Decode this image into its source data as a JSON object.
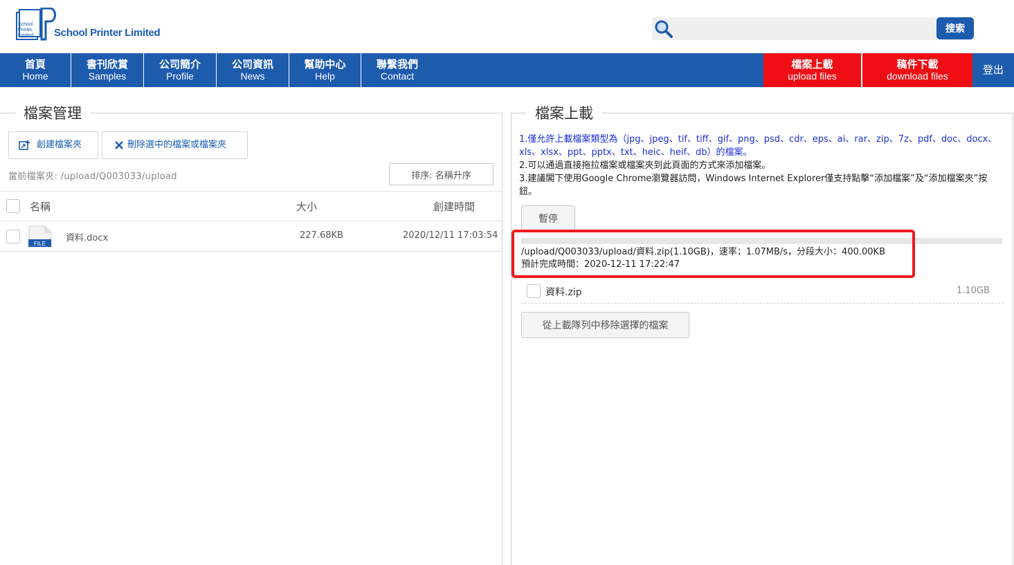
{
  "header": {
    "logo_text": "School Printer Limited",
    "logo_mark_lines": [
      "School",
      "Printer",
      "Limited"
    ],
    "search": {
      "placeholder": "",
      "button_label": "搜索"
    }
  },
  "nav": {
    "items": [
      {
        "zh": "首頁",
        "en": "Home"
      },
      {
        "zh": "書刊欣賞",
        "en": "Samples"
      },
      {
        "zh": "公司簡介",
        "en": "Profile"
      },
      {
        "zh": "公司資訊",
        "en": "News"
      },
      {
        "zh": "幫助中心",
        "en": "Help"
      },
      {
        "zh": "聯繫我們",
        "en": "Contact"
      }
    ],
    "actions": [
      {
        "zh": "檔案上載",
        "en": "upload files"
      },
      {
        "zh": "稿件下載",
        "en": "download files"
      }
    ],
    "logout_label": "登出"
  },
  "file_manager": {
    "title": "檔案管理",
    "create_folder_label": "創建檔案夾",
    "delete_selected_label": "刪除選中的檔案或檔案夾",
    "current_folder_label": "當前檔案夾: /upload/Q003033/upload",
    "sort_label": "排序: 名稱升序",
    "columns": {
      "name": "名稱",
      "size": "大小",
      "created": "創建時間"
    },
    "files": [
      {
        "icon_label": "FILE",
        "name": "資料.docx",
        "size": "227.68KB",
        "created": "2020/12/11 17:03:54"
      }
    ]
  },
  "uploader": {
    "title": "檔案上載",
    "rules": [
      "1.僅允許上載檔案類型為（jpg、jpeg、tif、tiff、gif、png、psd、cdr、eps、ai、rar、zip、7z、pdf、doc、docx、xls、xlsx、ppt、pptx、txt、heic、heif、db）的檔案。",
      "2.可以通過直接拖拉檔案或檔案夾到此頁面的方式來添加檔案。",
      "3.建議閣下使用Google Chrome瀏覽器訪問，Windows Internet Explorer僅支持點擊“添加檔案”及“添加檔案夾”按鈕。"
    ],
    "pause_label": "暫停",
    "progress": 0.0,
    "status_line1": "/upload/Q003033/upload/資料.zip(1.10GB)，速率：1.07MB/s，分段大小：400.00KB",
    "status_line2": "預計完成時間：2020-12-11 17:22:47",
    "queue": [
      {
        "name": "資料.zip",
        "size": "1.10GB"
      }
    ],
    "remove_label": "從上載隊列中移除選擇的檔案"
  },
  "colors": {
    "brand_blue": "#1d5bad",
    "accent_red": "#ee0e14",
    "highlight_red": "#ee1c1c",
    "rule_blue": "#1c2fd8"
  }
}
